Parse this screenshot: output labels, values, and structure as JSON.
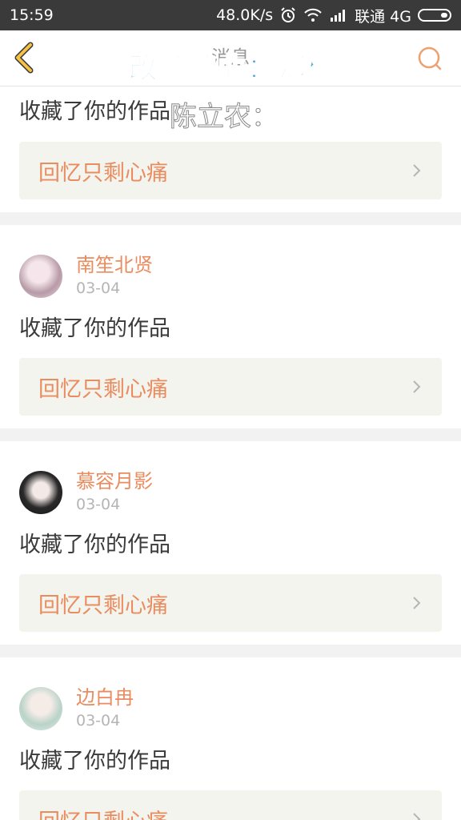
{
  "status_bar": {
    "time": "15:59",
    "network_speed": "48.0K/s",
    "carrier": "联通 4G",
    "icons": [
      "alarm-icon",
      "wifi-icon",
      "signal-icon",
      "battery-icon"
    ]
  },
  "header": {
    "title": "消息",
    "back_icon": "chevron-left-icon",
    "search_icon": "search-icon",
    "accent_color": "#f5c244"
  },
  "overlay": {
    "line1": "改编编曲：郑楠",
    "line2": "陈立农："
  },
  "notifications": [
    {
      "action": "收藏了你的作品",
      "work_title": "回忆只剩心痛"
    },
    {
      "user": "南笙北贤",
      "date": "03-04",
      "action": "收藏了你的作品",
      "work_title": "回忆只剩心痛"
    },
    {
      "user": "慕容月影",
      "date": "03-04",
      "action": "收藏了你的作品",
      "work_title": "回忆只剩心痛"
    },
    {
      "user": "边白冉",
      "date": "03-04",
      "action": "收藏了你的作品",
      "work_title": "回忆只剩心痛"
    }
  ],
  "colors": {
    "name": "#e98c5f",
    "work_title": "#e98c5f",
    "date": "#b5b5b5",
    "work_box_bg": "#f4f4ee",
    "divider": "#f2f2f2"
  }
}
